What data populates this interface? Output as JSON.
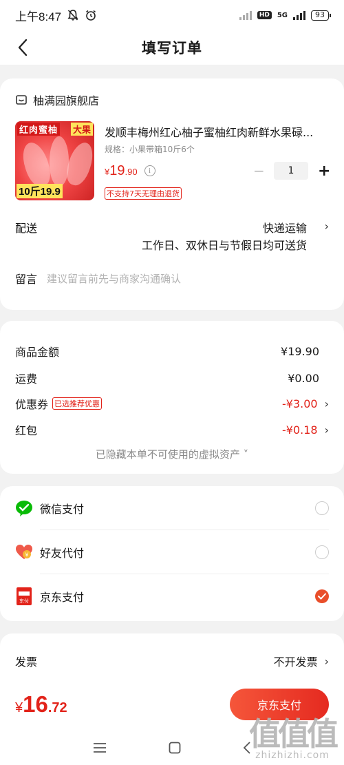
{
  "status_bar": {
    "time": "上午8:47",
    "network": "5G",
    "hd": "HD",
    "battery": "93"
  },
  "nav": {
    "title": "填写订单"
  },
  "store": {
    "name": "柚满园旗舰店"
  },
  "product": {
    "image_text_1": "红肉蜜柚",
    "image_text_2": "大果",
    "image_text_3": "10斤19.9",
    "name": "发顺丰梅州红心柚子蜜柚红肉新鲜水果碌...",
    "spec": "规格：小果带箱10斤6个",
    "price_yen": "¥",
    "price_int": "19",
    "price_dec": ".90",
    "quantity": "1",
    "minus": "−",
    "plus": "+",
    "tag": "不支持7天无理由退货"
  },
  "delivery": {
    "label": "配送",
    "value": "快递运输",
    "note": "工作日、双休日与节假日均可送货"
  },
  "message": {
    "label": "留言",
    "placeholder": "建议留言前先与商家沟通确认"
  },
  "summary": {
    "goods_label": "商品金额",
    "goods_value": "¥19.90",
    "shipping_label": "运费",
    "shipping_value": "¥0.00",
    "coupon_label": "优惠券",
    "coupon_badge": "已选推荐优惠",
    "coupon_value": "-¥3.00",
    "redpacket_label": "红包",
    "redpacket_value": "-¥0.18",
    "hidden_note": "已隐藏本单不可使用的虚拟资产 ˅"
  },
  "payment": {
    "options": [
      {
        "label": "微信支付",
        "icon": "wechat-pay-icon",
        "selected": false
      },
      {
        "label": "好友代付",
        "icon": "friend-pay-icon",
        "selected": false
      },
      {
        "label": "京东支付",
        "icon": "jd-pay-icon",
        "selected": true
      }
    ],
    "jd_icon_text": "东付"
  },
  "invoice": {
    "label": "发票",
    "value": "不开发票"
  },
  "footer": {
    "total_yen": "¥",
    "total_int": "16",
    "total_dec": ".72",
    "pay_button": "京东支付"
  },
  "watermark": {
    "line1": "值值值",
    "line2": "zhizhizhi.com"
  },
  "colors": {
    "accent_red": "#e2231a",
    "button_gradient_start": "#f5563a",
    "button_gradient_end": "#e52a20",
    "wechat_green": "#09bb07"
  }
}
